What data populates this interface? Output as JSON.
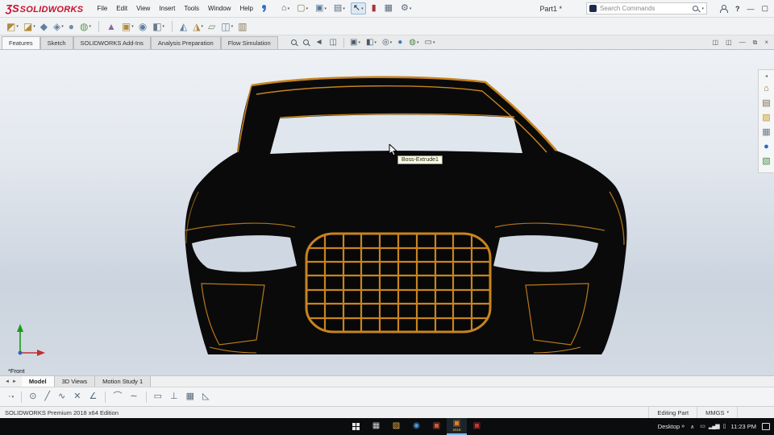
{
  "colors": {
    "accent_orange": "#c8841f",
    "solidworks_red": "#c8102e",
    "viewport_top": "#eef1f5",
    "viewport_bottom": "#cbd4df",
    "taskbar_black": "#0b0c0e"
  },
  "titlebar": {
    "logo_mark": "ƷS",
    "logo_text": "SOLIDWORKS",
    "menus": [
      "File",
      "Edit",
      "View",
      "Insert",
      "Tools",
      "Window",
      "Help"
    ],
    "quick_icons": [
      {
        "name": "home-icon",
        "glyph": "⌂",
        "color": "#4a5868",
        "dd": "▾"
      },
      {
        "name": "open-document-icon",
        "glyph": "▢",
        "color": "#8a7a4a",
        "dd": "▾"
      },
      {
        "name": "save-icon",
        "glyph": "▣",
        "color": "#5a7a9a",
        "dd": "▾"
      },
      {
        "name": "print-icon",
        "glyph": "▤",
        "color": "#5a6a7a",
        "dd": "▾"
      },
      {
        "name": "select-cursor-icon",
        "glyph": "↖",
        "color": "#222222",
        "dd": "▾",
        "cls": "boxed"
      },
      {
        "name": "rebuild-icon",
        "glyph": "▮",
        "color": "#b03030"
      },
      {
        "name": "evaluate-grid-icon",
        "glyph": "▦",
        "color": "#5a6a7a"
      },
      {
        "name": "options-gear-icon",
        "glyph": "⚙",
        "color": "#5a6a7a",
        "dd": "▾"
      }
    ],
    "document_title": "Part1 *",
    "search_placeholder": "Search Commands",
    "window": {
      "help": "?",
      "minimize": "—",
      "maximize": "▢"
    }
  },
  "toolbar2": {
    "icons": [
      {
        "name": "toolbar-icon",
        "glyph": "◩",
        "color": "#b08a3e",
        "dd": "▾"
      },
      {
        "name": "toolbar-icon",
        "glyph": "◪",
        "color": "#b08a3e",
        "dd": "▾"
      },
      {
        "name": "toolbar-icon",
        "glyph": "◆",
        "color": "#5f7f9f"
      },
      {
        "name": "toolbar-icon",
        "glyph": "◈",
        "color": "#5f7f9f",
        "dd": "▾"
      },
      {
        "name": "toolbar-icon",
        "glyph": "●",
        "color": "#6f8fa8"
      },
      {
        "name": "toolbar-icon",
        "glyph": "◍",
        "color": "#5a9a5a",
        "dd": "▾"
      },
      {
        "cls": "sep"
      },
      {
        "name": "toolbar-icon",
        "glyph": "▲",
        "color": "#8a6a9a"
      },
      {
        "name": "toolbar-icon",
        "glyph": "▣",
        "color": "#b08a3e",
        "dd": "▾"
      },
      {
        "name": "toolbar-icon",
        "glyph": "◉",
        "color": "#5f7f9f"
      },
      {
        "name": "toolbar-icon",
        "glyph": "◧",
        "color": "#6a7a8a",
        "dd": "▾"
      },
      {
        "cls": "sep"
      },
      {
        "name": "toolbar-icon",
        "glyph": "◭",
        "color": "#5f7f9f"
      },
      {
        "name": "toolbar-icon",
        "glyph": "◮",
        "color": "#b08a3e",
        "dd": "▾"
      },
      {
        "name": "toolbar-icon",
        "glyph": "▱",
        "color": "#6a8a6a"
      },
      {
        "name": "toolbar-icon",
        "glyph": "◫",
        "color": "#5f7f9f",
        "dd": "▾"
      },
      {
        "name": "toolbar-icon",
        "glyph": "▥",
        "color": "#8a7a5a"
      }
    ]
  },
  "command_tabs": [
    {
      "label": "Features",
      "active": true
    },
    {
      "label": "Sketch"
    },
    {
      "label": "SOLIDWORKS Add-Ins"
    },
    {
      "label": "Analysis Preparation"
    },
    {
      "label": "Flow Simulation"
    }
  ],
  "headsup": {
    "icons": [
      {
        "name": "zoom-fit-icon",
        "cls": "mag"
      },
      {
        "name": "zoom-area-icon",
        "cls": "mag"
      },
      {
        "name": "previous-view-icon",
        "glyph": "◄"
      },
      {
        "name": "section-view-icon",
        "glyph": "◫"
      },
      {
        "cls": "sep"
      },
      {
        "name": "view-orientation-icon",
        "glyph": "▣",
        "dd": "▾"
      },
      {
        "name": "display-style-icon",
        "glyph": "◧",
        "dd": "▾"
      },
      {
        "name": "hide-show-items-icon",
        "glyph": "◎",
        "dd": "▾"
      },
      {
        "name": "edit-appearance-icon",
        "glyph": "●",
        "color": "#3a7ac0"
      },
      {
        "name": "apply-scene-icon",
        "glyph": "◍",
        "color": "#4a8a4a",
        "dd": "▾"
      },
      {
        "name": "view-settings-icon",
        "glyph": "▭",
        "dd": "▾"
      }
    ]
  },
  "doc_window_icons": [
    {
      "name": "pane-display-icon",
      "glyph": "◫"
    },
    {
      "name": "pane-display-icon-2",
      "glyph": "◫"
    },
    {
      "name": "doc-minimize-icon",
      "glyph": "—"
    },
    {
      "name": "doc-restore-icon",
      "glyph": "⧉"
    },
    {
      "name": "doc-close-icon",
      "glyph": "×"
    }
  ],
  "viewport": {
    "tooltip": "Boss-Extrude1",
    "view_label": "*Front"
  },
  "taskpane": {
    "collapse_glyph": "◂",
    "icons": [
      {
        "name": "solidworks-resources-icon",
        "glyph": "⌂",
        "color": "#8a6a2a"
      },
      {
        "name": "design-library-icon",
        "glyph": "▤",
        "color": "#7a6a4a"
      },
      {
        "name": "file-explorer-icon",
        "glyph": "▨",
        "color": "#c0962a"
      },
      {
        "name": "view-palette-icon",
        "glyph": "▦",
        "color": "#6a7a8a"
      },
      {
        "name": "appearances-icon",
        "glyph": "●",
        "color": "#2a6ac0"
      },
      {
        "name": "custom-properties-icon",
        "glyph": "▧",
        "color": "#4a8a4a"
      }
    ]
  },
  "bottom_nav": [
    {
      "name": "prev-tab-icon",
      "glyph": "◄"
    },
    {
      "name": "next-tab-icon",
      "glyph": "►"
    }
  ],
  "model_tabs": [
    {
      "label": "Model",
      "active": true
    },
    {
      "label": "3D Views"
    },
    {
      "label": "Motion Study 1"
    }
  ],
  "sketchbar": {
    "icons": [
      {
        "name": "sketch-tool-icon",
        "glyph": "·",
        "dd": "▾"
      },
      {
        "cls": "sep"
      },
      {
        "name": "sketch-tool-icon",
        "glyph": "⊙"
      },
      {
        "name": "sketch-tool-icon",
        "glyph": "╱"
      },
      {
        "name": "sketch-tool-icon",
        "glyph": "∿"
      },
      {
        "name": "sketch-tool-icon",
        "glyph": "✕"
      },
      {
        "name": "sketch-tool-icon",
        "glyph": "∠"
      },
      {
        "cls": "sep"
      },
      {
        "name": "sketch-tool-icon",
        "glyph": "⌒"
      },
      {
        "name": "sketch-tool-icon",
        "glyph": "∼"
      },
      {
        "cls": "sep"
      },
      {
        "name": "sketch-tool-icon",
        "glyph": "▭"
      },
      {
        "name": "sketch-tool-icon",
        "glyph": "⊥"
      },
      {
        "name": "sketch-tool-icon",
        "glyph": "▦"
      },
      {
        "name": "sketch-tool-icon",
        "glyph": "◺"
      }
    ]
  },
  "statusbar": {
    "edition": "SOLIDWORKS Premium 2018 x64 Edition",
    "editing": "Editing Part",
    "units": "MMGS",
    "units_caret": "▾"
  },
  "taskbar": {
    "icons": [
      {
        "name": "task-view-icon",
        "glyph": "▦",
        "color": "#cfd4d9"
      },
      {
        "name": "file-explorer-icon",
        "glyph": "▨",
        "color": "#e8b64c"
      },
      {
        "name": "browser-icon",
        "glyph": "◉",
        "color": "#4a9ae0"
      },
      {
        "name": "app-icon-red",
        "glyph": "▣",
        "color": "#d05a3a"
      },
      {
        "name": "solidworks-2018-icon",
        "glyph": "▣",
        "color": "#e0822e",
        "label": "2018",
        "running": true
      },
      {
        "name": "app-icon-maroon",
        "glyph": "▣",
        "color": "#c03838"
      }
    ],
    "desktop_label": "Desktop",
    "overflow_chevron": "»",
    "tray_chevron": "∧",
    "tray_icons": [
      {
        "name": "tray-keyboard-icon",
        "glyph": "▭"
      },
      {
        "name": "tray-network-icon",
        "glyph": "▂▄▆"
      },
      {
        "name": "tray-battery-icon",
        "glyph": "▯"
      }
    ],
    "time": "11:23 PM"
  }
}
